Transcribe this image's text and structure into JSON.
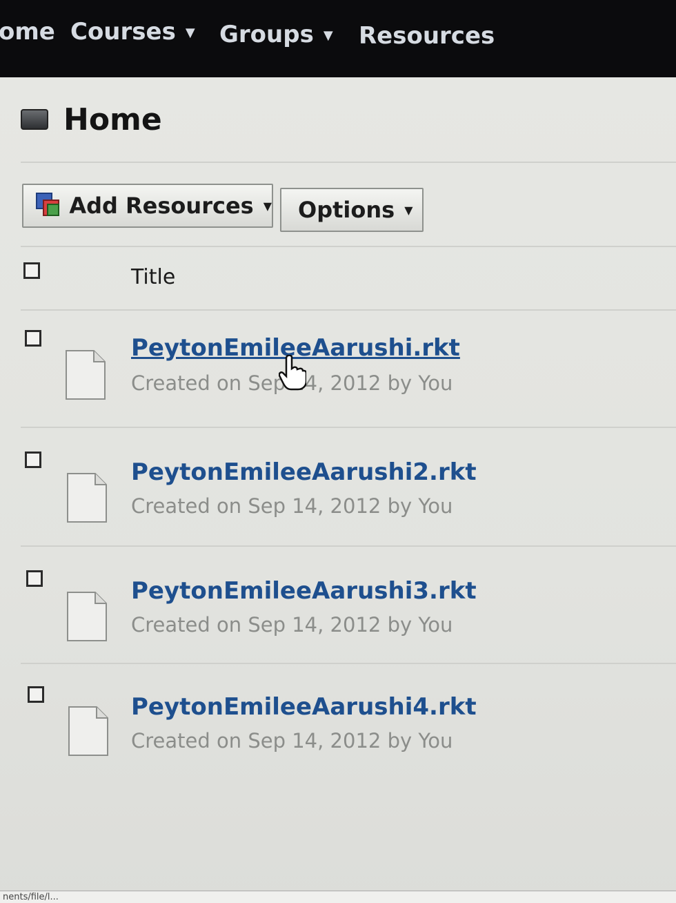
{
  "nav": {
    "items": [
      {
        "label": "ome"
      },
      {
        "label": "Courses",
        "caret": "▼"
      },
      {
        "label": "Groups",
        "caret": "▼"
      },
      {
        "label": "Resources"
      }
    ]
  },
  "page": {
    "title": "Home",
    "icon": "folder-icon"
  },
  "toolbar": {
    "add_label": "Add Resources",
    "options_label": "Options",
    "caret": "▼"
  },
  "table": {
    "column_title": "Title",
    "rows": [
      {
        "name": "PeytonEmileeAarushi.rkt",
        "meta": "Created on Sep 14, 2012 by You"
      },
      {
        "name": "PeytonEmileeAarushi2.rkt",
        "meta": "Created on Sep 14, 2012 by You"
      },
      {
        "name": "PeytonEmileeAarushi3.rkt",
        "meta": "Created on Sep 14, 2012 by You"
      },
      {
        "name": "PeytonEmileeAarushi4.rkt",
        "meta": "Created on Sep 14, 2012 by You"
      }
    ]
  },
  "status": {
    "text": "nents/file/l..."
  },
  "colors": {
    "nav_bg": "#0b0b0d",
    "link": "#1e4f8e",
    "meta": "#8b8d8a"
  }
}
